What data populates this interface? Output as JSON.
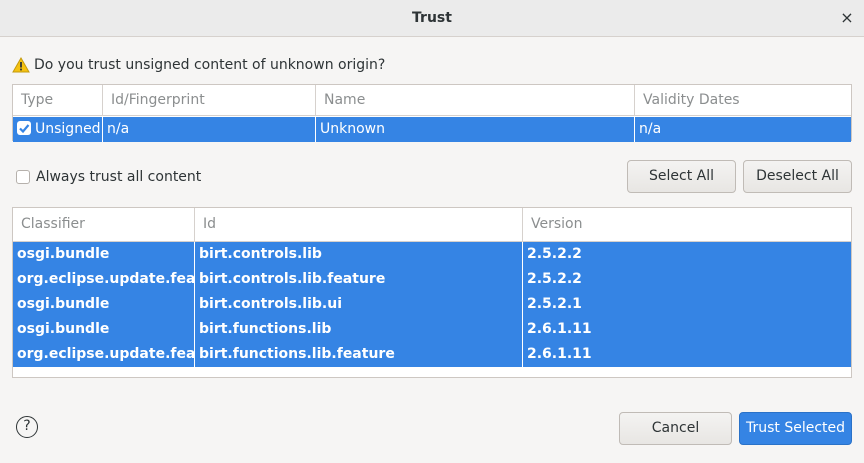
{
  "window": {
    "title": "Trust",
    "close_glyph": "×"
  },
  "question": {
    "text": "Do you trust unsigned content of unknown origin?",
    "icon": "warning-icon",
    "icon_color": "#f5c211"
  },
  "signers_table": {
    "columns": [
      "Type",
      "Id/Fingerprint",
      "Name",
      "Validity Dates"
    ],
    "rows": [
      {
        "type": "Unsigned",
        "checked": true,
        "id": "n/a",
        "name": "Unknown",
        "validity": "n/a"
      }
    ]
  },
  "always_trust": {
    "label": "Always trust all content",
    "checked": false
  },
  "buttons": {
    "select_all": "Select All",
    "deselect_all": "Deselect All",
    "cancel": "Cancel",
    "trust_selected": "Trust Selected"
  },
  "artifacts_table": {
    "columns": [
      "Classifier",
      "Id",
      "Version"
    ],
    "rows": [
      {
        "classifier": "osgi.bundle",
        "id": "birt.controls.lib",
        "version": "2.5.2.2"
      },
      {
        "classifier": "org.eclipse.update.feature",
        "id": "birt.controls.lib.feature",
        "version": "2.5.2.2"
      },
      {
        "classifier": "osgi.bundle",
        "id": "birt.controls.lib.ui",
        "version": "2.5.2.1"
      },
      {
        "classifier": "osgi.bundle",
        "id": "birt.functions.lib",
        "version": "2.6.1.11"
      },
      {
        "classifier": "org.eclipse.update.feature",
        "id": "birt.functions.lib.feature",
        "version": "2.6.1.11"
      }
    ]
  },
  "help": {
    "glyph": "?",
    "icon": "help-icon"
  },
  "colors": {
    "selection": "#3584e4",
    "background": "#f6f5f4"
  }
}
